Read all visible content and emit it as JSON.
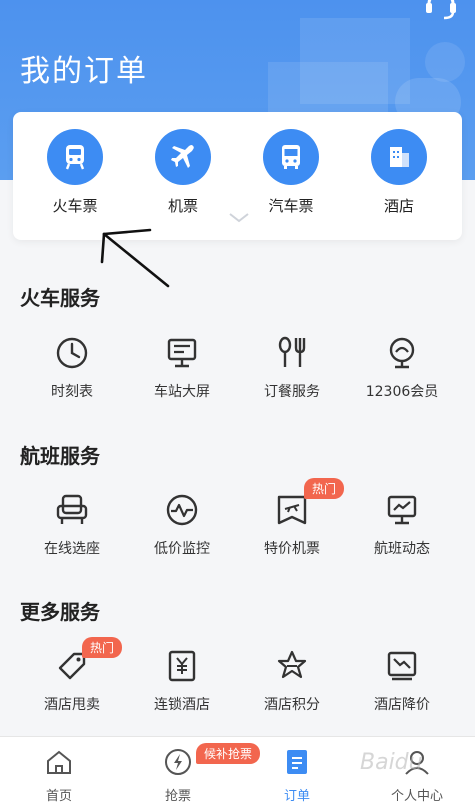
{
  "header": {
    "title": "我的订单"
  },
  "categories": [
    {
      "label": "火车票",
      "icon": "train-icon"
    },
    {
      "label": "机票",
      "icon": "airplane-icon"
    },
    {
      "label": "汽车票",
      "icon": "bus-icon"
    },
    {
      "label": "酒店",
      "icon": "hotel-icon"
    }
  ],
  "sections": {
    "train": {
      "title": "火车服务",
      "items": [
        {
          "label": "时刻表",
          "icon": "clock-icon"
        },
        {
          "label": "车站大屏",
          "icon": "station-screen-icon"
        },
        {
          "label": "订餐服务",
          "icon": "meal-icon"
        },
        {
          "label": "12306会员",
          "icon": "member-icon"
        }
      ]
    },
    "flight": {
      "title": "航班服务",
      "items": [
        {
          "label": "在线选座",
          "icon": "seat-icon"
        },
        {
          "label": "低价监控",
          "icon": "price-monitor-icon"
        },
        {
          "label": "特价机票",
          "icon": "discount-ticket-icon",
          "badge": "热门"
        },
        {
          "label": "航班动态",
          "icon": "flight-status-icon"
        }
      ]
    },
    "more": {
      "title": "更多服务",
      "items": [
        {
          "label": "酒店甩卖",
          "icon": "tag-icon",
          "badge": "热门"
        },
        {
          "label": "连锁酒店",
          "icon": "chain-hotel-icon"
        },
        {
          "label": "酒店积分",
          "icon": "points-icon"
        },
        {
          "label": "酒店降价",
          "icon": "price-drop-icon"
        }
      ]
    }
  },
  "tabbar": {
    "items": [
      {
        "label": "首页",
        "icon": "home-icon"
      },
      {
        "label": "抢票",
        "icon": "grab-ticket-icon"
      },
      {
        "label": "订单",
        "icon": "order-icon",
        "active": true
      },
      {
        "label": "个人中心",
        "icon": "profile-icon"
      }
    ],
    "waitlist_badge": "候补抢票"
  },
  "watermark": "Baidu",
  "colors": {
    "primary": "#3d8cf3",
    "header": "#4d92ee",
    "badge": "#f2664e"
  }
}
